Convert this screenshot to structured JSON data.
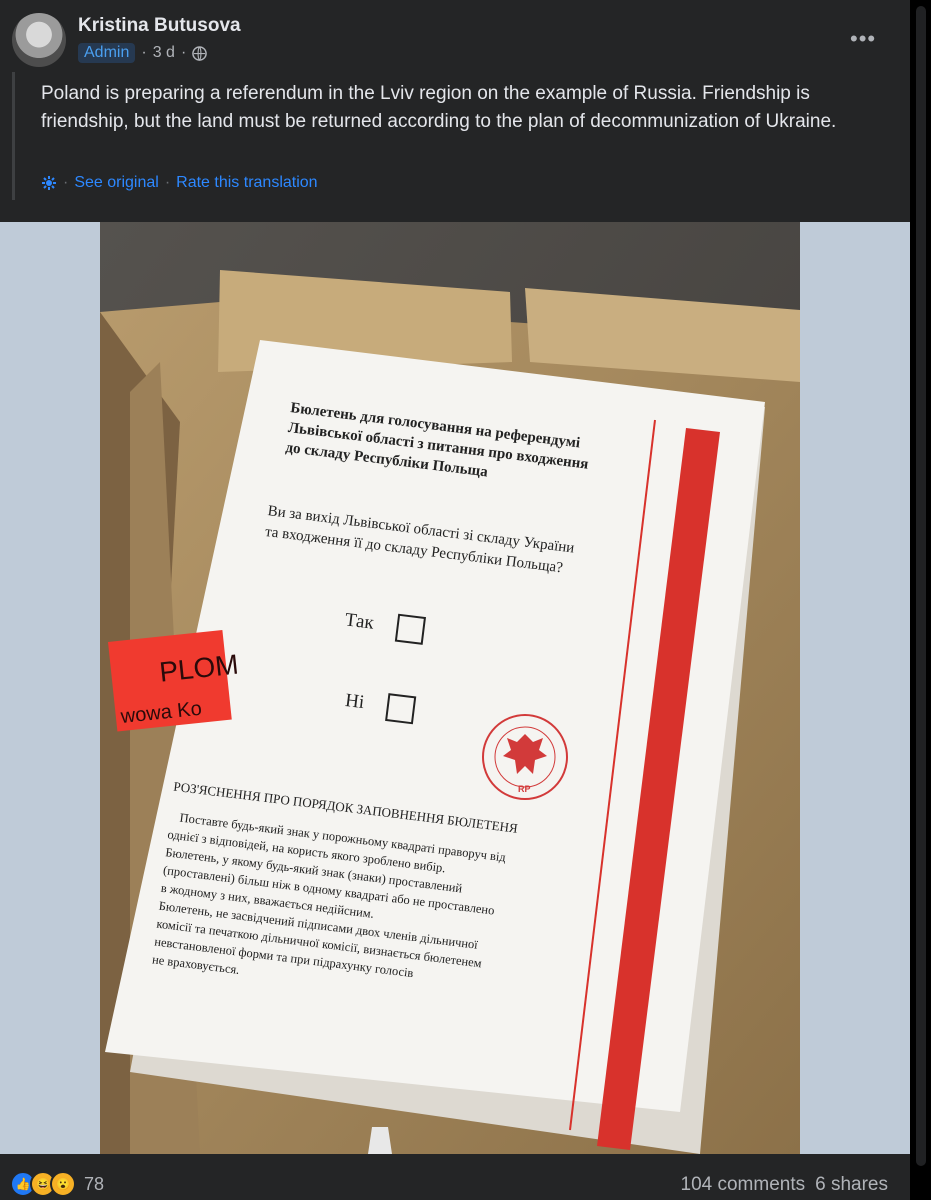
{
  "post": {
    "author": "Kristina Butusova",
    "role_badge": "Admin",
    "time": "3 d",
    "more_label": "•••",
    "text": "Poland is preparing a referendum in the Lviv region on the example of Russia. Friendship is friendship, but the land must be returned according to the plan of decommunization of Ukraine.",
    "see_original": "See original",
    "rate_translation": "Rate this translation"
  },
  "photo": {
    "ballot_title": "Бюлетень для голосування на референдумі Львівської області з питання про входження до складу Республіки Польща",
    "question": "Ви за вихід Львівської області зі складу України та входження її до складу Республіки Польща?",
    "option_yes": "Так",
    "option_no": "Ні",
    "seal_text": "RP",
    "instructions_title": "РОЗ'ЯСНЕННЯ ПРО ПОРЯДОК ЗАПОВНЕННЯ БЮЛЕТЕНЯ",
    "instructions_lines": [
      "Поставте будь-який знак у порожньому квадраті праворуч від",
      "однієї з відповідей, на користь якого зроблено вибір.",
      "Бюлетень, у якому будь-який знак (знаки) проставлений",
      "(проставлені) більш ніж в одному квадраті або не проставлено",
      "в жодному з них, вважається недійсним.",
      "Бюлетень, не засвідчений підписами двох членів дільничної",
      "комісії та печаткою дільничної комісії, визнається бюлетенем",
      "невстановленої форми та при підрахунку голосів",
      "не враховується."
    ],
    "seal_tape_line1": "PLOM",
    "seal_tape_line2": "wowa Ko"
  },
  "footer": {
    "reaction_count": "78",
    "comments": "104 comments",
    "shares": "6 shares"
  },
  "colors": {
    "card_bg": "#242526",
    "link_blue": "#2d88ff",
    "ballot_red": "#d8322c"
  }
}
